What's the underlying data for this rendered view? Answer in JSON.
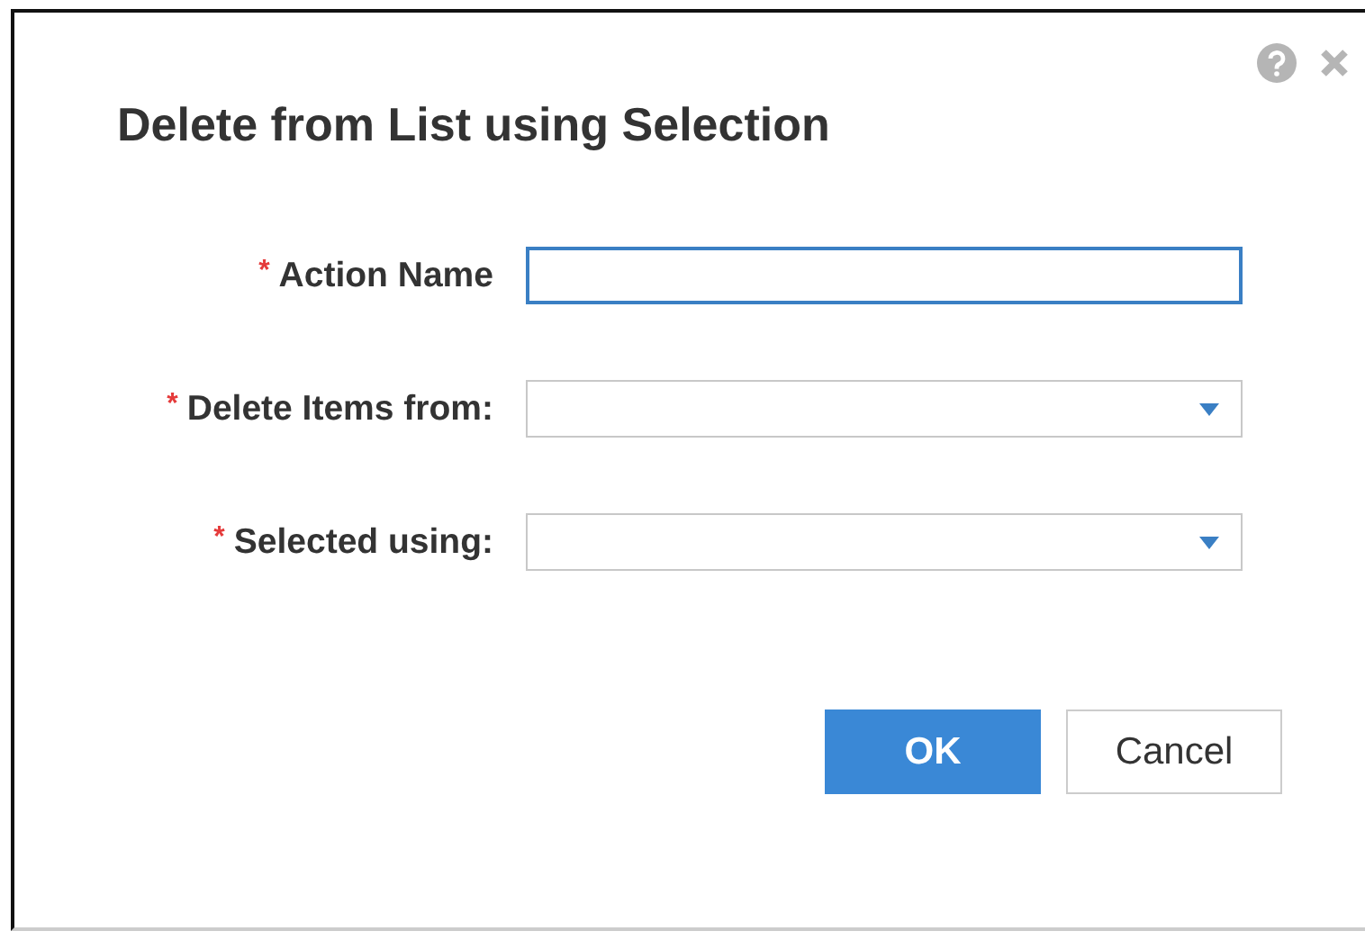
{
  "dialog": {
    "title": "Delete from List using Selection"
  },
  "fields": [
    {
      "label": "Action Name",
      "required_mark": "*",
      "kind": "text",
      "focused": true
    },
    {
      "label": "Delete Items from:",
      "required_mark": "*",
      "kind": "select",
      "focused": false
    },
    {
      "label": "Selected using:",
      "required_mark": "*",
      "kind": "select",
      "focused": false
    }
  ],
  "buttons": [
    {
      "label": "OK",
      "kind": "primary"
    },
    {
      "label": "Cancel",
      "kind": "secondary"
    }
  ]
}
